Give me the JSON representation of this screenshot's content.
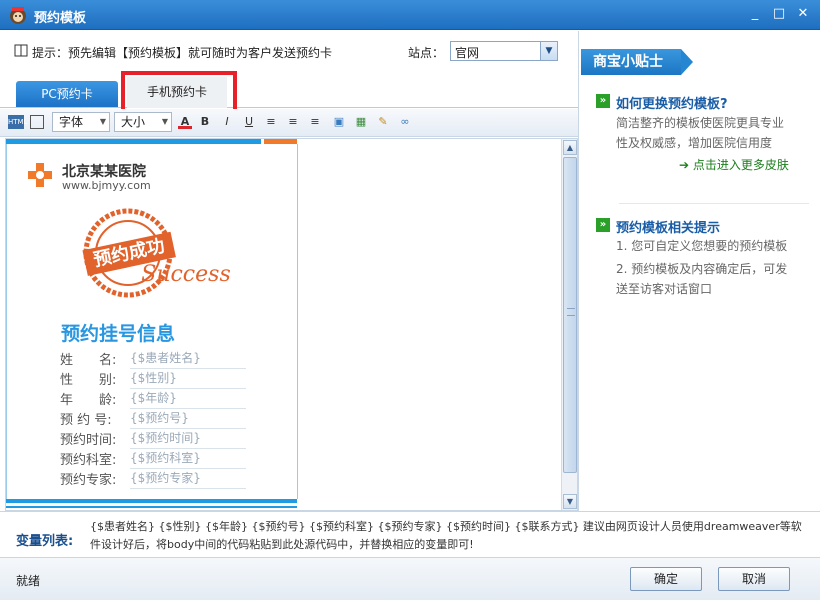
{
  "window": {
    "title": "预约模板",
    "minimize": "_",
    "maximize": "□",
    "close": "✕"
  },
  "hint": {
    "text": "提示：预先编辑【预约模板】就可随时为客户发送预约卡",
    "site_label": "站点：",
    "site_value": "官网"
  },
  "tabs": [
    {
      "label": "PC预约卡"
    },
    {
      "label": "手机预约卡"
    }
  ],
  "toolbar": {
    "font_combo": "字体",
    "size_combo": "大小"
  },
  "card": {
    "hospital_name": "北京某某医院",
    "hospital_url": "www.bjmyy.com",
    "stamp_text": "预约成功",
    "stamp_script": "Success",
    "info_title": "预约挂号信息",
    "fields": [
      {
        "label": "姓　　名:",
        "value": "{$患者姓名}"
      },
      {
        "label": "性　　别:",
        "value": "{$性别}"
      },
      {
        "label": "年　　龄:",
        "value": "{$年龄}"
      },
      {
        "label": "预 约 号:",
        "value": "{$预约号}"
      },
      {
        "label": "预约时间:",
        "value": "{$预约时间}"
      },
      {
        "label": "预约科室:",
        "value": "{$预约科室}"
      },
      {
        "label": "预约专家:",
        "value": "{$预约专家}"
      }
    ]
  },
  "tips": {
    "panel_title": "商宝小贴士",
    "section1": {
      "title": "如何更换预约模板?",
      "text": "简洁整齐的模板使医院更具专业性及权威感，增加医院信用度",
      "link": "点击进入更多皮肤"
    },
    "section2": {
      "title": "预约模板相关提示",
      "item1": "1. 您可自定义您想要的预约模板",
      "item2": "2. 预约模板及内容确定后，可发送至访客对话窗口"
    }
  },
  "variables": {
    "label": "变量列表:",
    "text": "{$患者姓名} {$性别} {$年龄} {$预约号} {$预约科室} {$预约专家} {$预约时间} {$联系方式} 建议由网页设计人员使用dreamweaver等软件设计好后，将body中间的代码粘贴到此处源代码中，并替换相应的变量即可!"
  },
  "status": {
    "text": "就绪",
    "ok": "确定",
    "cancel": "取消"
  },
  "colors": {
    "accent": "#1e9be3",
    "highlight": "#e8202a",
    "stamp": "#e2622b"
  }
}
